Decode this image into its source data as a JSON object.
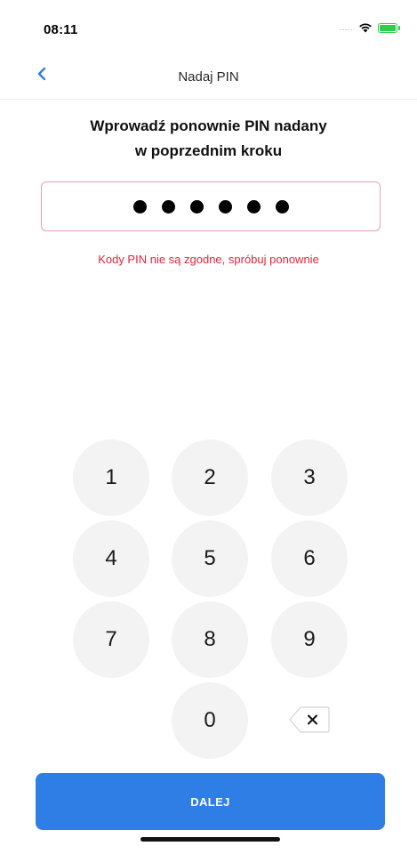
{
  "status_bar": {
    "time": "08:11",
    "signal": ".....",
    "icons": [
      "wifi-icon",
      "battery-charging-icon"
    ],
    "battery_color": "#2bd04a"
  },
  "nav": {
    "title": "Nadaj PIN",
    "back_icon": "chevron-left-icon"
  },
  "instruction": {
    "line1": "Wprowadź ponownie PIN nadany",
    "line2": "w poprzednim kroku"
  },
  "pin": {
    "entered_digits": 6,
    "mask_char": "•"
  },
  "error": {
    "text": "Kody PIN nie są zgodne, spróbuj ponownie",
    "color": "#e0243a"
  },
  "keypad": {
    "keys": [
      "1",
      "2",
      "3",
      "4",
      "5",
      "6",
      "7",
      "8",
      "9",
      "0"
    ],
    "delete_icon": "backspace-icon",
    "delete_glyph": "×"
  },
  "footer": {
    "next_label": "DALEJ",
    "accent": "#2f7ee6"
  }
}
